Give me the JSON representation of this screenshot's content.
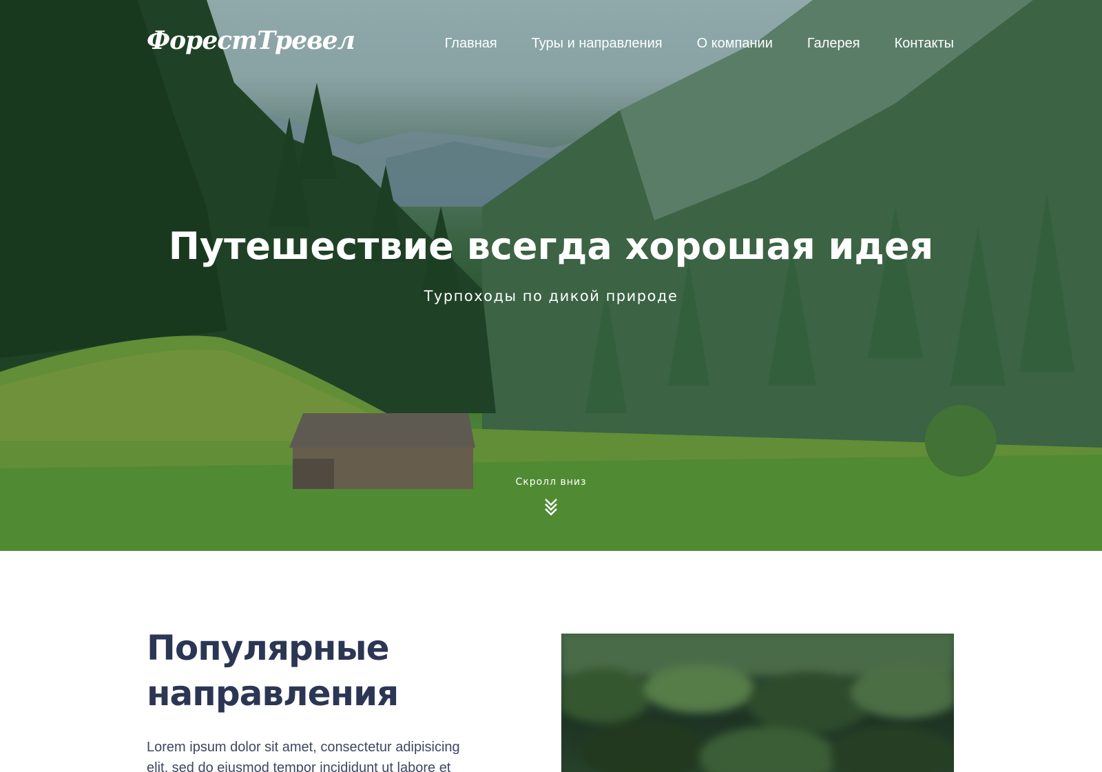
{
  "brand": {
    "logo_text": "ФорестТревел"
  },
  "nav": {
    "items": [
      {
        "label": "Главная"
      },
      {
        "label": "Туры и направления"
      },
      {
        "label": "О компании"
      },
      {
        "label": "Галерея"
      },
      {
        "label": "Контакты"
      }
    ]
  },
  "hero": {
    "title": "Путешествие всегда хорошая идея",
    "subtitle": "Турпоходы по дикой природе",
    "scroll_label": "Скролл вниз",
    "scroll_icon": "double-chevron-down-icon"
  },
  "popular": {
    "title": "Популярные направления",
    "text": "Lorem ipsum dolor sit amet, consectetur adipisicing elit, sed do eiusmod tempor incididunt ut labore et"
  },
  "colors": {
    "heading": "#2c3654",
    "body_text": "#3e4660",
    "hero_text": "#ffffff"
  }
}
